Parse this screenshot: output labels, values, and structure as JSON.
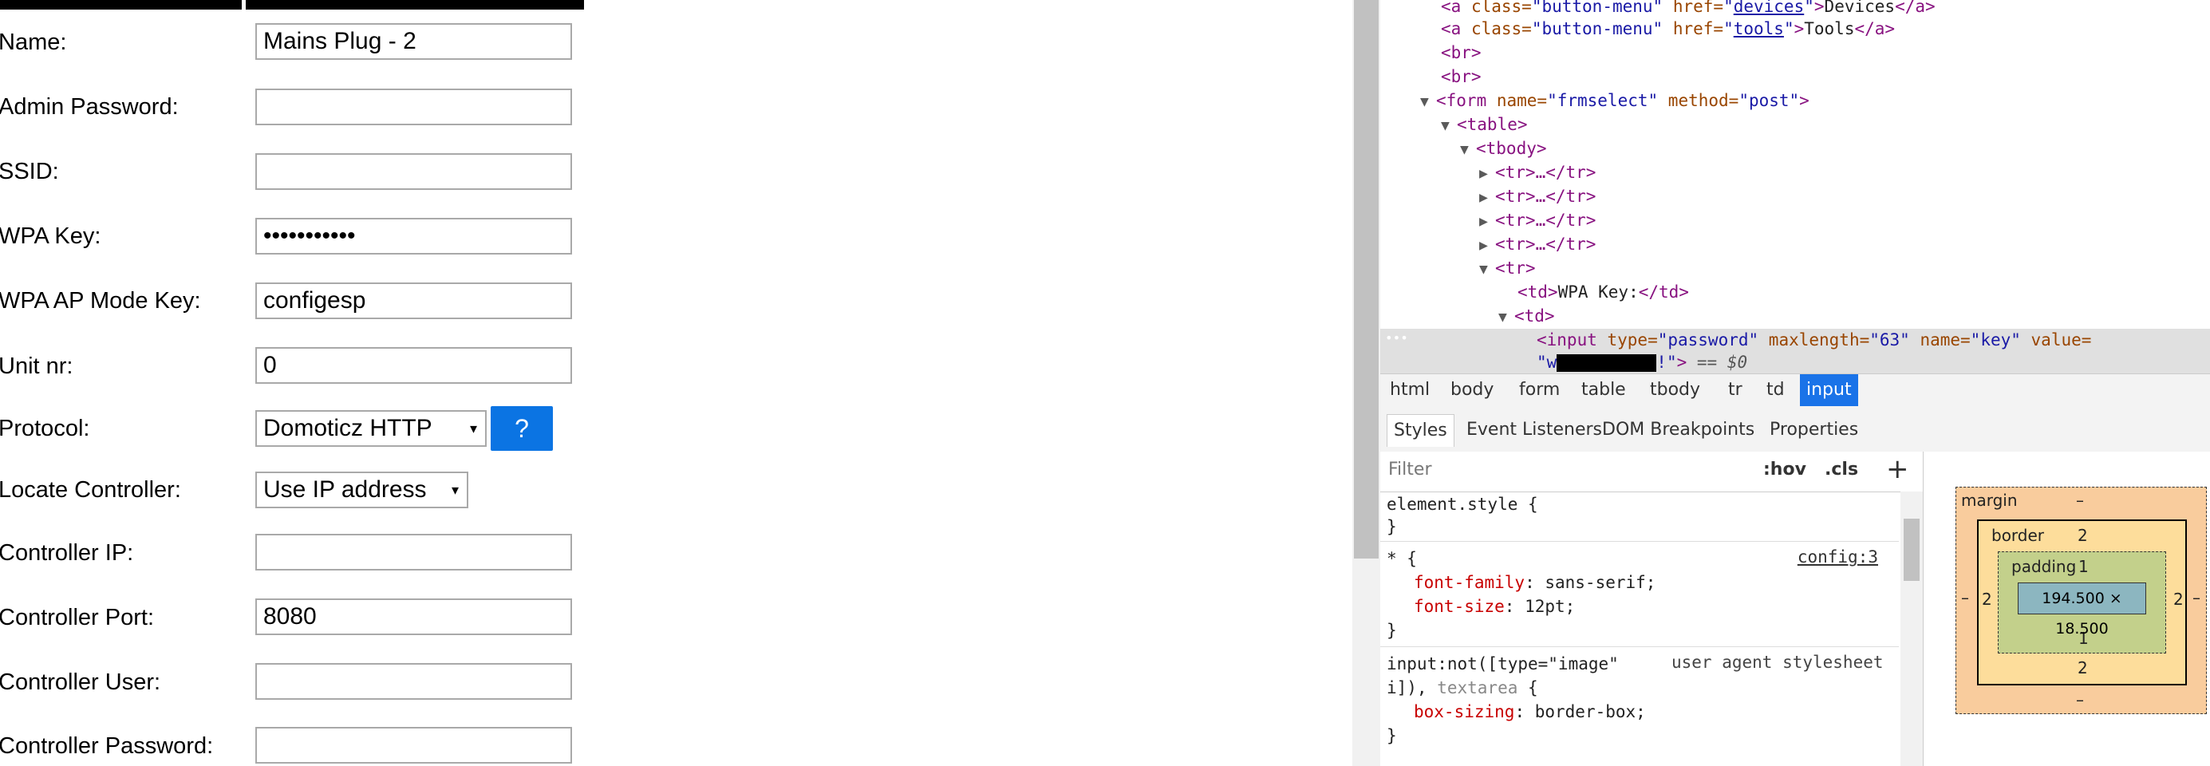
{
  "form": {
    "rows": [
      {
        "label": "Name:",
        "value": "Mains Plug - 2"
      },
      {
        "label": "Admin Password:",
        "value": ""
      },
      {
        "label": "SSID:",
        "value": ""
      },
      {
        "label": "WPA Key:",
        "value": "•••••••••••"
      },
      {
        "label": "WPA AP Mode Key:",
        "value": "configesp"
      },
      {
        "label": "Unit nr:",
        "value": "0"
      },
      {
        "label": "Protocol:",
        "value": "Domoticz HTTP"
      },
      {
        "label": "Locate Controller:",
        "value": "Use IP address"
      },
      {
        "label": "Controller IP:",
        "value": ""
      },
      {
        "label": "Controller Port:",
        "value": "8080"
      },
      {
        "label": "Controller User:",
        "value": ""
      },
      {
        "label": "Controller Password:",
        "value": ""
      }
    ],
    "help_button": "?",
    "select_arrow": "▾"
  },
  "devtools": {
    "dom": {
      "l0": {
        "pre": "<",
        "tag": "a",
        "a1": " class=",
        "v1": "\"button-menu\"",
        "a2": " href=",
        "q1": "\"",
        "link": "devices",
        "q2": "\"",
        "post": ">",
        "text": "Devices",
        "end": "</a>"
      },
      "l1": {
        "pre": "<",
        "tag": "a",
        "a1": " class=",
        "v1": "\"button-menu\"",
        "a2": " href=",
        "q1": "\"",
        "link": "tools",
        "q2": "\"",
        "post": ">",
        "text": "Tools",
        "end": "</a>"
      },
      "l2": "<br>",
      "l3": "<br>",
      "l4": {
        "tri": "▼",
        "open": "<form",
        "a1": " name=",
        "v1": "\"frmselect\"",
        "a2": " method=",
        "v2": "\"post\"",
        "close": ">"
      },
      "l5": {
        "tri": "▼",
        "tag": "<table>"
      },
      "l6": {
        "tri": "▼",
        "tag": "<tbody>"
      },
      "l7": {
        "tri": "▶",
        "tag": "<tr>…</tr>"
      },
      "l8": {
        "tri": "▶",
        "tag": "<tr>…</tr>"
      },
      "l9": {
        "tri": "▶",
        "tag": "<tr>…</tr>"
      },
      "l10": {
        "tri": "▶",
        "tag": "<tr>…</tr>"
      },
      "l11": {
        "tri": "▼",
        "tag": "<tr>"
      },
      "l12": {
        "open": "<td>",
        "text": "WPA Key:",
        "close": "</td>"
      },
      "l13": {
        "tri": "▼",
        "tag": "<td>"
      },
      "l14": {
        "open": "<input",
        "a1": " type=",
        "v1": "\"password\"",
        "a2": " maxlength=",
        "v2": "\"63\"",
        "a3": " name=",
        "v3": "\"key\"",
        "a4": " value="
      },
      "l15": {
        "q": "\"w",
        "tail": "!\"",
        "close": ">",
        "eq": " == $0"
      },
      "dots": "•••"
    },
    "breadcrumbs": [
      "html",
      "body",
      "form",
      "table",
      "tbody",
      "tr",
      "td",
      "input"
    ],
    "tabs": [
      "Styles",
      "Event Listeners",
      "DOM Breakpoints",
      "Properties"
    ],
    "filter": {
      "placeholder": "Filter",
      "hov": ":hov",
      "cls": ".cls",
      "plus": "+"
    },
    "css": {
      "r1_sel": "element.style {",
      "r1_end": "}",
      "r2_sel": "* {",
      "r2_src": "config:3",
      "r2_p1": "font-family",
      "r2_v1": ": sans-serif;",
      "r2_p2": "font-size",
      "r2_v2": ": 12pt;",
      "r2_end": "}",
      "r3_sel1": "input:not([type=\"image\"",
      "r3_ua": "user agent stylesheet",
      "r3_sel2a": "i]), ",
      "r3_sel2b": "textarea",
      "r3_sel2c": " {",
      "r3_p1": "box-sizing",
      "r3_v1": ": border-box;",
      "r3_end": "}"
    },
    "box_model": {
      "margin_label": "margin",
      "margin_val": "–",
      "border_label": "border",
      "border_val": "2",
      "padding_label": "padding",
      "padding_val": "1",
      "content": "194.500 × 18.500",
      "side_border": "2",
      "side_margin": "–",
      "bottom_padding": "1",
      "bottom_border": "2",
      "bottom_margin": "–"
    }
  }
}
